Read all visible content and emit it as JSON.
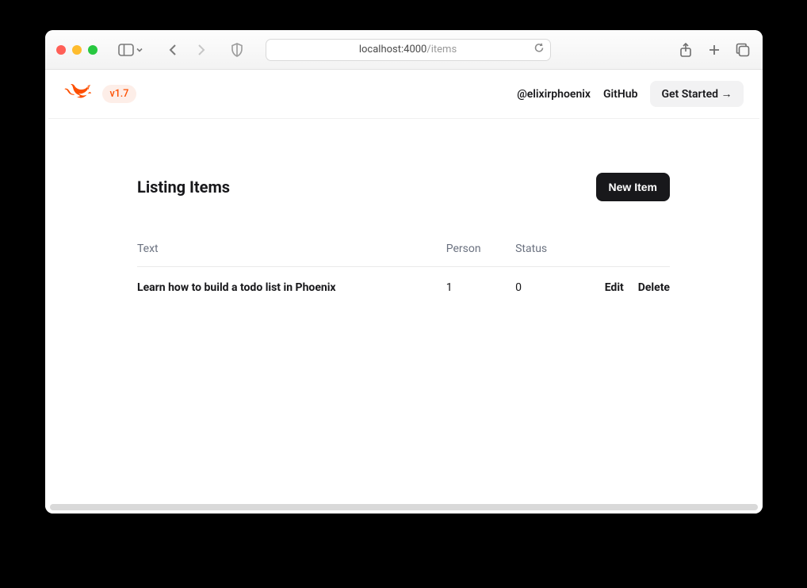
{
  "browser": {
    "address_host": "localhost:4000",
    "address_path": "/items"
  },
  "header": {
    "version": "v1.7",
    "links": {
      "twitter": "@elixirphoenix",
      "github": "GitHub",
      "get_started": "Get Started →"
    }
  },
  "page": {
    "title": "Listing Items",
    "new_button": "New Item",
    "columns": {
      "text": "Text",
      "person": "Person",
      "status": "Status"
    },
    "actions": {
      "edit": "Edit",
      "delete": "Delete"
    },
    "rows": [
      {
        "text": "Learn how to build a todo list in Phoenix",
        "person": "1",
        "status": "0"
      }
    ]
  }
}
